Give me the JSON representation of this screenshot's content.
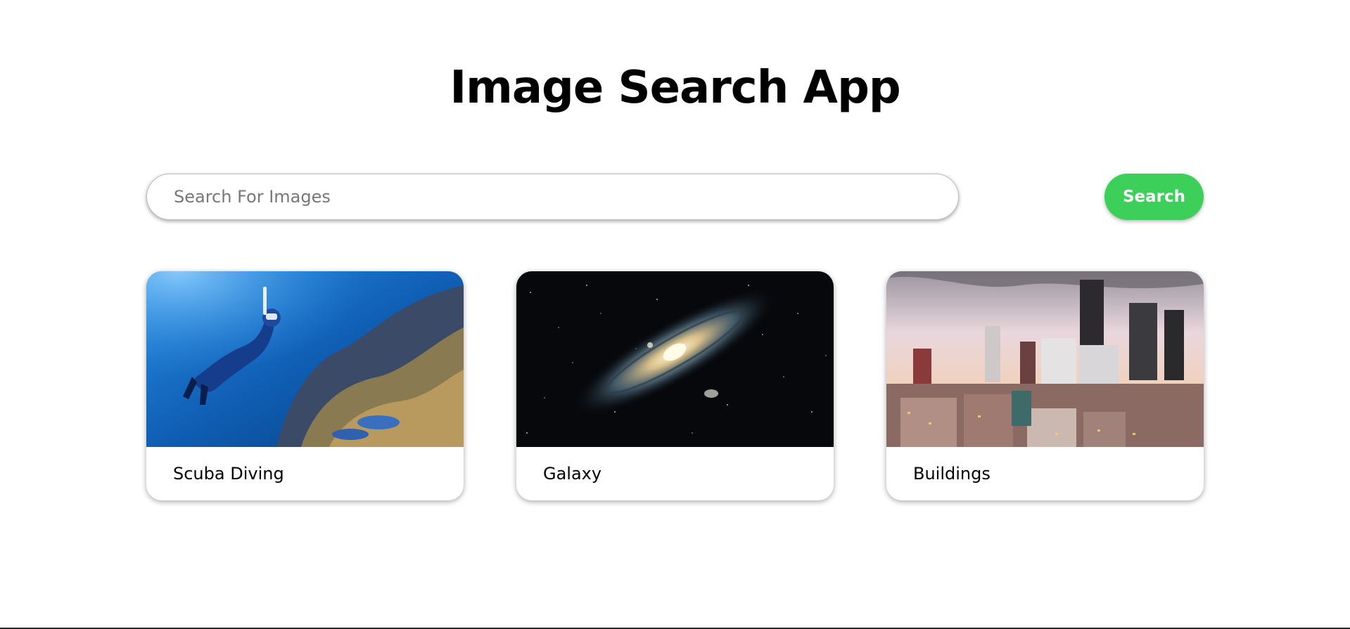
{
  "header": {
    "title": "Image Search App"
  },
  "search": {
    "placeholder": "Search For Images",
    "value": "",
    "button_label": "Search"
  },
  "results": [
    {
      "label": "Scuba Diving",
      "image": "scuba-diver-coral-reef"
    },
    {
      "label": "Galaxy",
      "image": "andromeda-galaxy"
    },
    {
      "label": "Buildings",
      "image": "city-skyline-dusk"
    }
  ],
  "colors": {
    "accent": "#3ccf5a",
    "text": "#000000",
    "background": "#ffffff"
  }
}
